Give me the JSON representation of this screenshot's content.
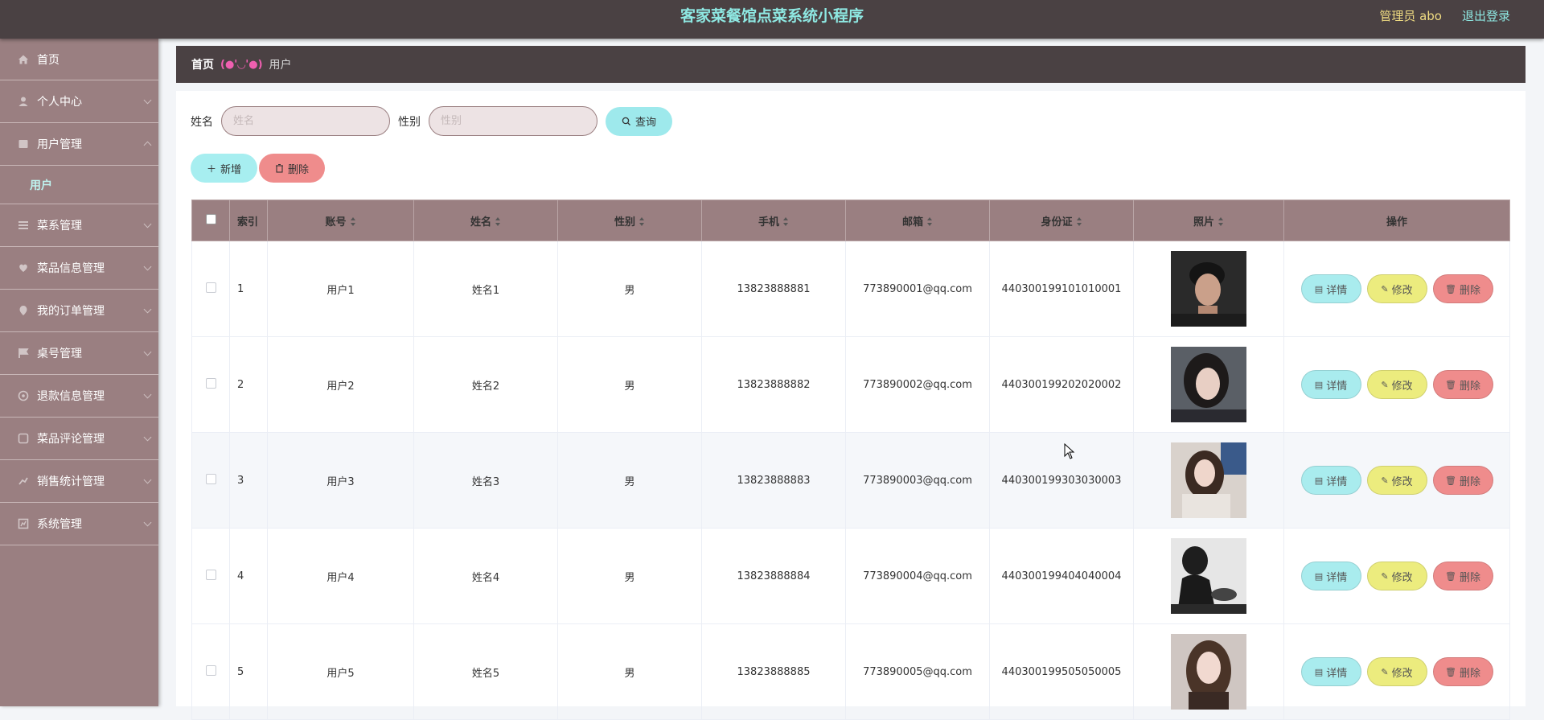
{
  "header": {
    "app_title": "客家菜餐馆点菜系统小程序",
    "admin_label": "管理员 abo",
    "logout_label": "退出登录"
  },
  "sidebar": {
    "items": [
      {
        "label": "首页",
        "icon": "home-icon"
      },
      {
        "label": "个人中心",
        "icon": "user-icon"
      },
      {
        "label": "用户管理",
        "icon": "users-icon"
      },
      {
        "label": "菜系管理",
        "icon": "list-icon"
      },
      {
        "label": "菜品信息管理",
        "icon": "dish-icon"
      },
      {
        "label": "我的订单管理",
        "icon": "order-icon"
      },
      {
        "label": "桌号管理",
        "icon": "table-icon"
      },
      {
        "label": "退款信息管理",
        "icon": "refund-icon"
      },
      {
        "label": "菜品评论管理",
        "icon": "comment-icon"
      },
      {
        "label": "销售统计管理",
        "icon": "stats-icon"
      },
      {
        "label": "系统管理",
        "icon": "settings-icon"
      }
    ],
    "sub_item": "用户"
  },
  "breadcrumb": {
    "home": "首页",
    "separator": "(●'◡'●)",
    "current": "用户"
  },
  "search": {
    "name_label": "姓名",
    "name_placeholder": "姓名",
    "gender_label": "性别",
    "gender_placeholder": "性别",
    "query_label": "查询"
  },
  "actions": {
    "add_label": "新增",
    "delete_label": "删除"
  },
  "table": {
    "headers": {
      "index": "索引",
      "account": "账号",
      "name": "姓名",
      "gender": "性别",
      "phone": "手机",
      "email": "邮箱",
      "id_card": "身份证",
      "photo": "照片",
      "ops": "操作"
    },
    "op_labels": {
      "detail": "详情",
      "edit": "修改",
      "delete": "删除"
    },
    "rows": [
      {
        "index": "1",
        "account": "用户1",
        "name": "姓名1",
        "gender": "男",
        "phone": "13823888881",
        "email": "773890001@qq.com",
        "id_card": "440300199101010001"
      },
      {
        "index": "2",
        "account": "用户2",
        "name": "姓名2",
        "gender": "男",
        "phone": "13823888882",
        "email": "773890002@qq.com",
        "id_card": "440300199202020002"
      },
      {
        "index": "3",
        "account": "用户3",
        "name": "姓名3",
        "gender": "男",
        "phone": "13823888883",
        "email": "773890003@qq.com",
        "id_card": "440300199303030003"
      },
      {
        "index": "4",
        "account": "用户4",
        "name": "姓名4",
        "gender": "男",
        "phone": "13823888884",
        "email": "773890004@qq.com",
        "id_card": "440300199404040004"
      },
      {
        "index": "5",
        "account": "用户5",
        "name": "姓名5",
        "gender": "男",
        "phone": "13823888885",
        "email": "773890005@qq.com",
        "id_card": "440300199505050005"
      }
    ]
  },
  "colors": {
    "header_bg": "#4a4143",
    "sidebar_bg": "#9a7f81",
    "accent_cyan": "#8ee8e2",
    "table_header_bg": "#9a7f81",
    "delete_red": "#ef8c8c",
    "edit_yellow": "#ecec7e"
  }
}
